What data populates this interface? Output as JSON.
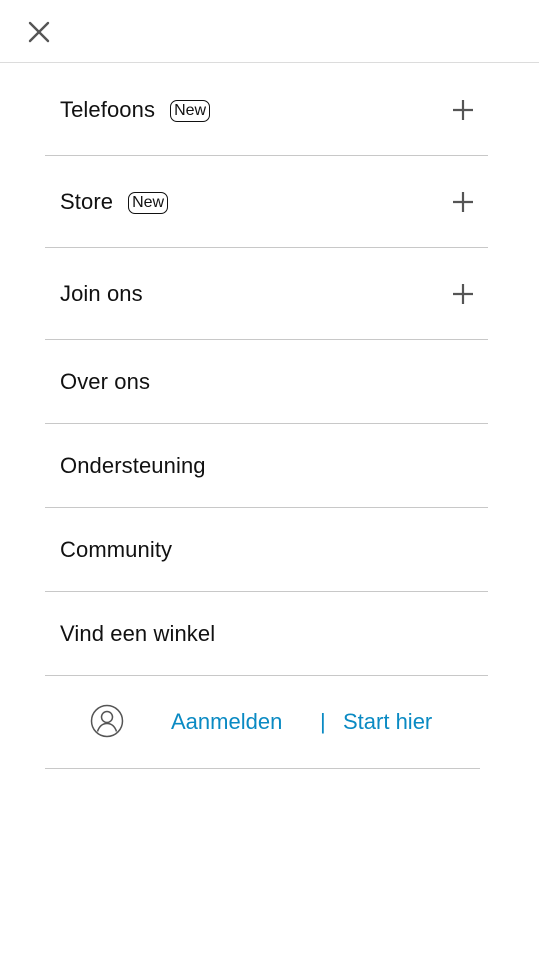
{
  "header": {
    "close_icon": "close-icon"
  },
  "menu": {
    "items": [
      {
        "label": "Telefoons",
        "badge": "New",
        "expand_icon": "plus-icon"
      },
      {
        "label": "Store",
        "badge": "New",
        "expand_icon": "plus-icon"
      },
      {
        "label": "Join ons",
        "expand_icon": "plus-icon"
      },
      {
        "label": "Over ons"
      },
      {
        "label": "Ondersteuning"
      },
      {
        "label": "Community"
      },
      {
        "label": "Vind een winkel"
      }
    ]
  },
  "account": {
    "avatar_icon": "user-avatar-icon",
    "signin_label": "Aanmelden",
    "separator": "|",
    "start_label": "Start hier"
  },
  "colors": {
    "link": "#0a8ac3",
    "divider": "#c8c8c8",
    "text": "#111111"
  }
}
